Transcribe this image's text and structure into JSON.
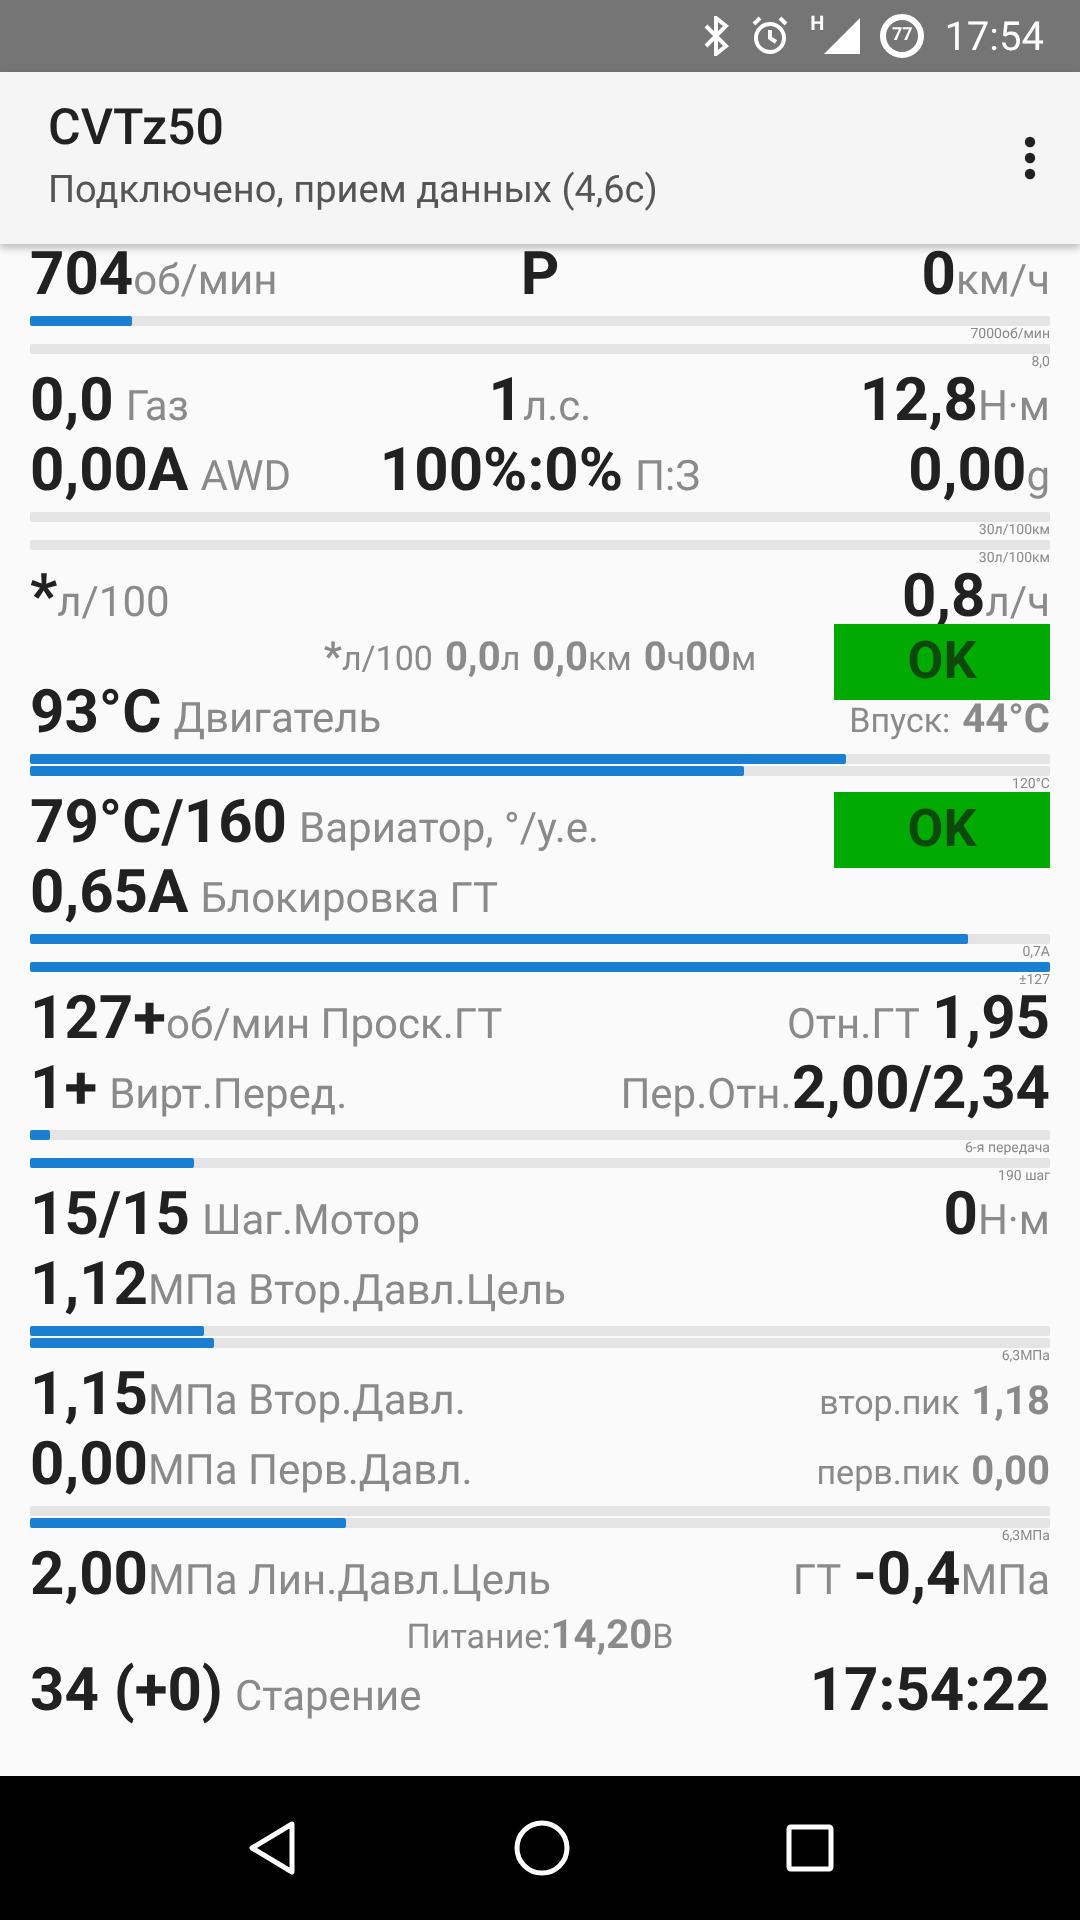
{
  "status_bar": {
    "network_type": "H",
    "battery": "77",
    "time": "17:54"
  },
  "app_bar": {
    "title": "CVTz50",
    "subtitle": "Подключено, прием данных (4,6с)"
  },
  "rows": [
    {
      "kind": "readout",
      "left": [
        {
          "text": "704",
          "kind": "value"
        },
        {
          "text": "об/мин",
          "kind": "unit"
        }
      ],
      "center": [
        {
          "text": "P",
          "kind": "value"
        }
      ],
      "right": [
        {
          "text": "0",
          "kind": "value"
        },
        {
          "text": "км/ч",
          "kind": "unit"
        }
      ]
    },
    {
      "kind": "bar",
      "level": 0.1,
      "scale": "7000об/мин"
    },
    {
      "kind": "bar",
      "scale": "8,0"
    },
    {
      "kind": "readout",
      "left": [
        {
          "text": "0,0",
          "kind": "value"
        },
        {
          "text": "Газ",
          "kind": "spaced_unit"
        }
      ],
      "center": [
        {
          "text": "1",
          "kind": "value"
        },
        {
          "text": "л.с.",
          "kind": "unit"
        }
      ],
      "right": [
        {
          "text": "12,8",
          "kind": "value"
        },
        {
          "text": "Н·м",
          "kind": "unit"
        }
      ]
    },
    {
      "kind": "readout",
      "left": [
        {
          "text": "0,00A",
          "kind": "value"
        },
        {
          "text": "AWD",
          "kind": "spaced_unit"
        }
      ],
      "center": [
        {
          "text": "100%:0%",
          "kind": "value"
        },
        {
          "text": "П:З",
          "kind": "spaced_unit"
        }
      ],
      "right": [
        {
          "text": "0,00",
          "kind": "value"
        },
        {
          "text": "g",
          "kind": "unit"
        }
      ]
    },
    {
      "kind": "bar",
      "scale": "30л/100км"
    },
    {
      "kind": "bar",
      "scale": "30л/100км"
    },
    {
      "kind": "readout",
      "left": [
        {
          "text": "*",
          "kind": "value"
        },
        {
          "text": "л/100",
          "kind": "unit"
        }
      ],
      "right": [
        {
          "text": "0,8",
          "kind": "value"
        },
        {
          "text": "л/ч",
          "kind": "unit"
        }
      ]
    },
    {
      "kind": "readout",
      "center": [
        {
          "text": "*",
          "kind": "minor_value"
        },
        {
          "text": "л/100",
          "kind": "minor_unit"
        },
        {
          "text": "0,0",
          "kind": "spaced_minor_value"
        },
        {
          "text": "л",
          "kind": "minor_unit"
        },
        {
          "text": "0,0",
          "kind": "spaced_minor_value"
        },
        {
          "text": "км",
          "kind": "minor_unit"
        },
        {
          "text": "0",
          "kind": "spaced_minor_value"
        },
        {
          "text": "ч",
          "kind": "minor_unit"
        },
        {
          "text": "00",
          "kind": "minor_value"
        },
        {
          "text": "м",
          "kind": "minor_unit"
        }
      ],
      "badge": {
        "text": "OK",
        "color": "#00aa00"
      }
    },
    {
      "kind": "readout",
      "left": [
        {
          "text": "93°C",
          "kind": "value"
        },
        {
          "text": "Двигатель",
          "kind": "spaced_unit"
        }
      ],
      "right": [
        {
          "text": "Впуск:",
          "kind": "minor_unit"
        },
        {
          "text": "44°C",
          "kind": "spaced_minor_value"
        }
      ]
    },
    {
      "kind": "bar",
      "level": 0.8
    },
    {
      "kind": "bar",
      "level": 0.7,
      "scale": "120°C"
    },
    {
      "kind": "readout",
      "left": [
        {
          "text": "79°C/160",
          "kind": "value"
        },
        {
          "text": "Вариатор, °/у.е.",
          "kind": "spaced_unit"
        }
      ],
      "badge": {
        "text": "OK",
        "color": "#00aa00"
      }
    },
    {
      "kind": "readout",
      "left": [
        {
          "text": "0,65A",
          "kind": "value"
        },
        {
          "text": "Блокировка ГТ",
          "kind": "spaced_unit"
        }
      ]
    },
    {
      "kind": "bar",
      "level": 0.92,
      "scale": "0,7A"
    },
    {
      "kind": "bar",
      "level": 1,
      "scale": "±127"
    },
    {
      "kind": "readout",
      "left": [
        {
          "text": "127+",
          "kind": "value"
        },
        {
          "text": "об/мин Проск.ГТ",
          "kind": "unit"
        }
      ],
      "right": [
        {
          "text": "Отн.ГТ",
          "kind": "unit"
        },
        {
          "text": "1,95",
          "kind": "spaced_value"
        }
      ]
    },
    {
      "kind": "readout",
      "left": [
        {
          "text": "1+",
          "kind": "value"
        },
        {
          "text": "Вирт.Перед.",
          "kind": "spaced_unit"
        }
      ],
      "right": [
        {
          "text": "Пер.Отн.",
          "kind": "unit"
        },
        {
          "text": "2,00/2,34",
          "kind": "value"
        }
      ]
    },
    {
      "kind": "bar",
      "level": 0.02,
      "scale": "6-я передача"
    },
    {
      "kind": "bar",
      "level": 0.16,
      "scale": "190 шаг"
    },
    {
      "kind": "readout",
      "left": [
        {
          "text": "15/15",
          "kind": "value"
        },
        {
          "text": "Шаг.Мотор",
          "kind": "spaced_unit"
        }
      ],
      "right": [
        {
          "text": "0",
          "kind": "value"
        },
        {
          "text": "Н·м",
          "kind": "unit"
        }
      ]
    },
    {
      "kind": "readout",
      "left": [
        {
          "text": "1,12",
          "kind": "value"
        },
        {
          "text": "МПа Втор.Давл.Цель",
          "kind": "unit"
        }
      ]
    },
    {
      "kind": "bar",
      "level": 0.17
    },
    {
      "kind": "bar",
      "level": 0.18,
      "scale": "6,3МПа"
    },
    {
      "kind": "readout",
      "left": [
        {
          "text": "1,15",
          "kind": "value"
        },
        {
          "text": "МПа Втор.Давл.",
          "kind": "unit"
        }
      ],
      "right": [
        {
          "text": "втор.пик",
          "kind": "minor_unit"
        },
        {
          "text": "1,18",
          "kind": "spaced_minor_value"
        }
      ]
    },
    {
      "kind": "readout",
      "left": [
        {
          "text": "0,00",
          "kind": "value"
        },
        {
          "text": "МПа Перв.Давл.",
          "kind": "unit"
        }
      ],
      "right": [
        {
          "text": "перв.пик",
          "kind": "minor_unit"
        },
        {
          "text": "0,00",
          "kind": "spaced_minor_value"
        }
      ]
    },
    {
      "kind": "bar"
    },
    {
      "kind": "bar",
      "level": 0.31,
      "scale": "6,3МПа"
    },
    {
      "kind": "readout",
      "left": [
        {
          "text": "2,00",
          "kind": "value"
        },
        {
          "text": "МПа Лин.Давл.Цель",
          "kind": "unit"
        }
      ],
      "right": [
        {
          "text": "ГТ",
          "kind": "unit"
        },
        {
          "text": "-0,4",
          "kind": "spaced_value"
        },
        {
          "text": "МПа",
          "kind": "unit"
        }
      ]
    },
    {
      "kind": "readout",
      "center": [
        {
          "text": "Питание:",
          "kind": "minor_unit"
        },
        {
          "text": "14,20",
          "kind": "minor_value"
        },
        {
          "text": "В",
          "kind": "minor_unit"
        }
      ]
    },
    {
      "kind": "readout",
      "left": [
        {
          "text": "34 (+0)",
          "kind": "value"
        },
        {
          "text": "Старение",
          "kind": "spaced_unit"
        }
      ],
      "right": [
        {
          "text": "17:54:22",
          "kind": "value"
        }
      ]
    }
  ]
}
